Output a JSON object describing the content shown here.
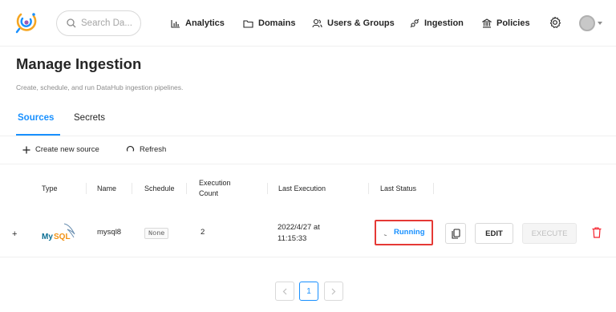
{
  "nav": {
    "search_placeholder": "Search Da...",
    "items": [
      {
        "label": "Analytics",
        "icon": "bar-chart-icon"
      },
      {
        "label": "Domains",
        "icon": "folder-icon"
      },
      {
        "label": "Users & Groups",
        "icon": "users-icon"
      },
      {
        "label": "Ingestion",
        "icon": "api-icon"
      },
      {
        "label": "Policies",
        "icon": "bank-icon"
      }
    ]
  },
  "page": {
    "title": "Manage Ingestion",
    "subtitle": "Create, schedule, and run DataHub ingestion pipelines."
  },
  "tabs": [
    {
      "label": "Sources",
      "active": true
    },
    {
      "label": "Secrets",
      "active": false
    }
  ],
  "toolbar": {
    "create_label": "Create new source",
    "refresh_label": "Refresh"
  },
  "table": {
    "headers": {
      "type": "Type",
      "name": "Name",
      "schedule": "Schedule",
      "execution_count_line1": "Execution",
      "execution_count_line2": "Count",
      "last_execution": "Last Execution",
      "last_status": "Last Status"
    },
    "rows": [
      {
        "expand": "+",
        "type_logo": "MySQL",
        "name": "mysql8",
        "schedule": "None",
        "execution_count": "2",
        "last_execution_line1": "2022/4/27 at",
        "last_execution_line2": "11:15:33",
        "last_status": "Running",
        "edit_label": "EDIT",
        "execute_label": "EXECUTE"
      }
    ]
  },
  "pagination": {
    "current_page": "1"
  },
  "colors": {
    "accent": "#1890ff",
    "highlight_border": "#e53935",
    "delete": "#f5222d"
  }
}
